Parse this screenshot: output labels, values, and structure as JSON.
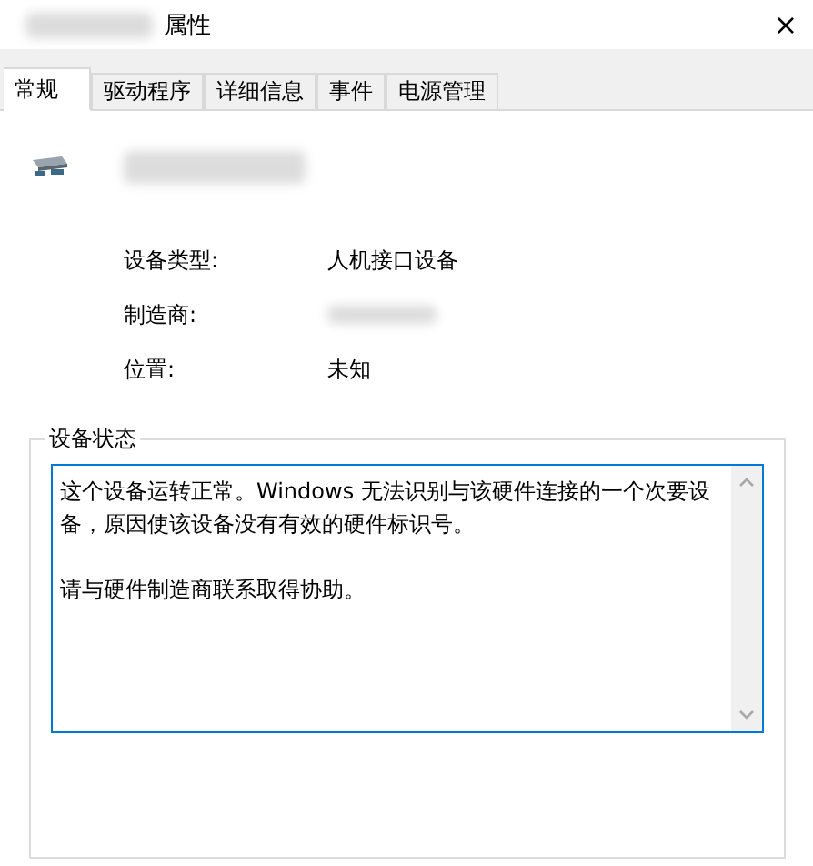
{
  "window": {
    "title": "属性",
    "close": "×"
  },
  "tabs": [
    {
      "label": "常规",
      "selected": true
    },
    {
      "label": "驱动程序",
      "selected": false
    },
    {
      "label": "详细信息",
      "selected": false
    },
    {
      "label": "事件",
      "selected": false
    },
    {
      "label": "电源管理",
      "selected": false
    }
  ],
  "properties": [
    {
      "label": "设备类型:",
      "value": "人机接口设备"
    },
    {
      "label": "制造商:"
    },
    {
      "label": "位置:",
      "value": "未知"
    }
  ],
  "device_status": {
    "legend": "设备状态",
    "paragraphs": [
      "这个设备运转正常。Windows 无法识别与该硬件连接的一个次要设备，原因使该设备没有有效的硬件标识号。",
      "请与硬件制造商联系取得协助。"
    ]
  }
}
